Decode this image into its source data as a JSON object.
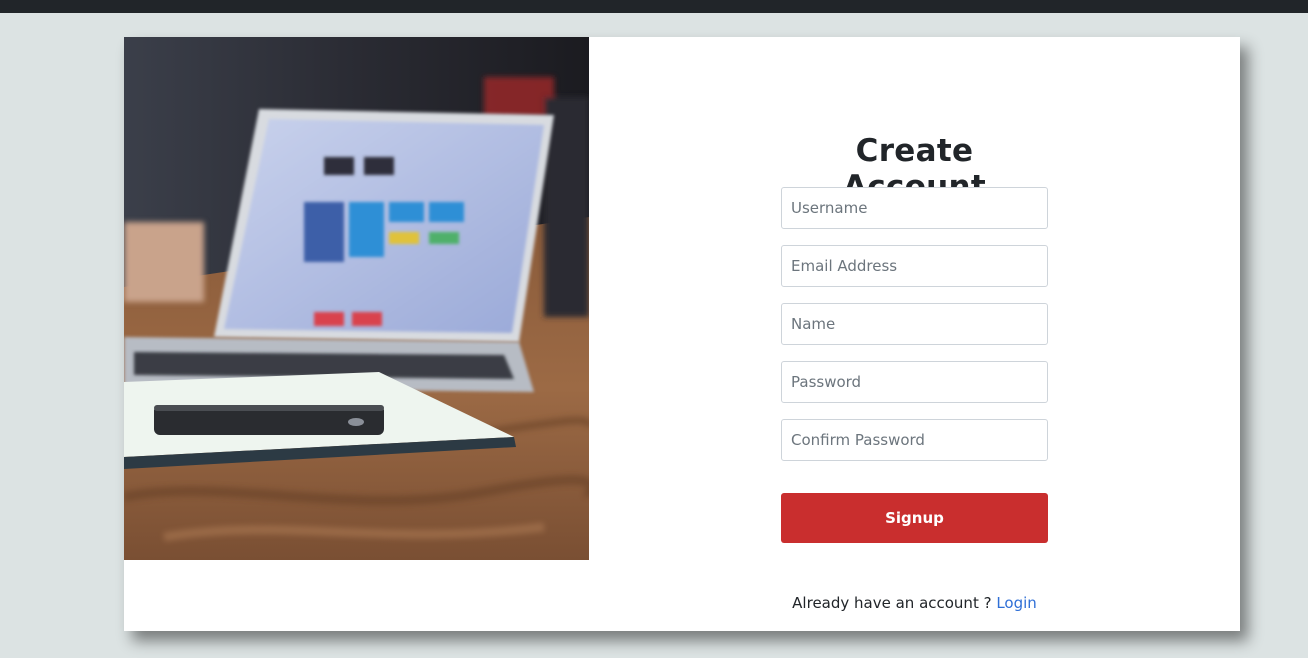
{
  "form": {
    "title": "Create Account",
    "fields": [
      {
        "placeholder": "Username",
        "value": ""
      },
      {
        "placeholder": "Email Address",
        "value": ""
      },
      {
        "placeholder": "Name",
        "value": ""
      },
      {
        "placeholder": "Password",
        "value": ""
      },
      {
        "placeholder": "Confirm Password",
        "value": ""
      }
    ],
    "submit_label": "Signup"
  },
  "footer": {
    "prompt": "Already have an account ?",
    "login_link": "Login"
  },
  "colors": {
    "page_background": "#dce3e3",
    "topbar": "#212529",
    "signup_button": "#c92e2e",
    "link": "#2f6fd6"
  }
}
